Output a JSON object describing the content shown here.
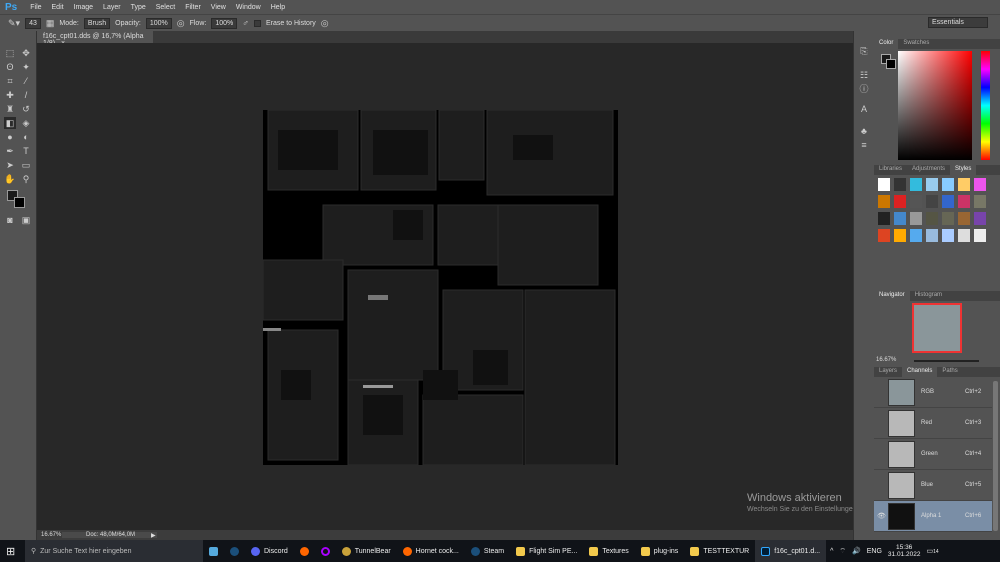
{
  "app": {
    "logo": "Ps",
    "menu": [
      "File",
      "Edit",
      "Image",
      "Layer",
      "Type",
      "Select",
      "Filter",
      "View",
      "Window",
      "Help"
    ]
  },
  "options": {
    "brush_size": "43",
    "mode_label": "Mode:",
    "mode_value": "Brush",
    "opacity_label": "Opacity:",
    "opacity_value": "100%",
    "flow_label": "Flow:",
    "flow_value": "100%",
    "erase_to_history": "Erase to History",
    "workspace": "Essentials"
  },
  "document": {
    "tab_title": "f16c_cpt01.dds @ 16,7% (Alpha 1/8)",
    "close": "×",
    "zoom": "16.67%",
    "doc_size": "Doc: 48,0M/64,0M"
  },
  "panels": {
    "color_tabs": [
      "Color",
      "Swatches"
    ],
    "styles_tabs": [
      "Libraries",
      "Adjustments",
      "Styles"
    ],
    "navigator_tabs": [
      "Navigator",
      "Histogram"
    ],
    "navigator_zoom": "16.67%",
    "layers_tabs": [
      "Layers",
      "Channels",
      "Paths"
    ],
    "channels": [
      {
        "name": "RGB",
        "shortcut": "Ctrl+2"
      },
      {
        "name": "Red",
        "shortcut": "Ctrl+3"
      },
      {
        "name": "Green",
        "shortcut": "Ctrl+4"
      },
      {
        "name": "Blue",
        "shortcut": "Ctrl+5"
      },
      {
        "name": "Alpha 1",
        "shortcut": "Ctrl+6"
      }
    ]
  },
  "watermark": {
    "title": "Windows aktivieren",
    "text": "Wechseln Sie zu den Einstellungen, um Windows zu aktivieren."
  },
  "taskbar": {
    "search_placeholder": "Zur Suche Text hier eingeben",
    "apps": [
      "Discord",
      "TunnelBear",
      "Hornet cock...",
      "Steam",
      "Flight Sim PE...",
      "Textures",
      "plug-ins",
      "TESTTEXTUR",
      "f16c_cpt01.d..."
    ],
    "lang": "ENG",
    "time": "15:36",
    "date": "31.01.2022",
    "notifications": "14"
  }
}
